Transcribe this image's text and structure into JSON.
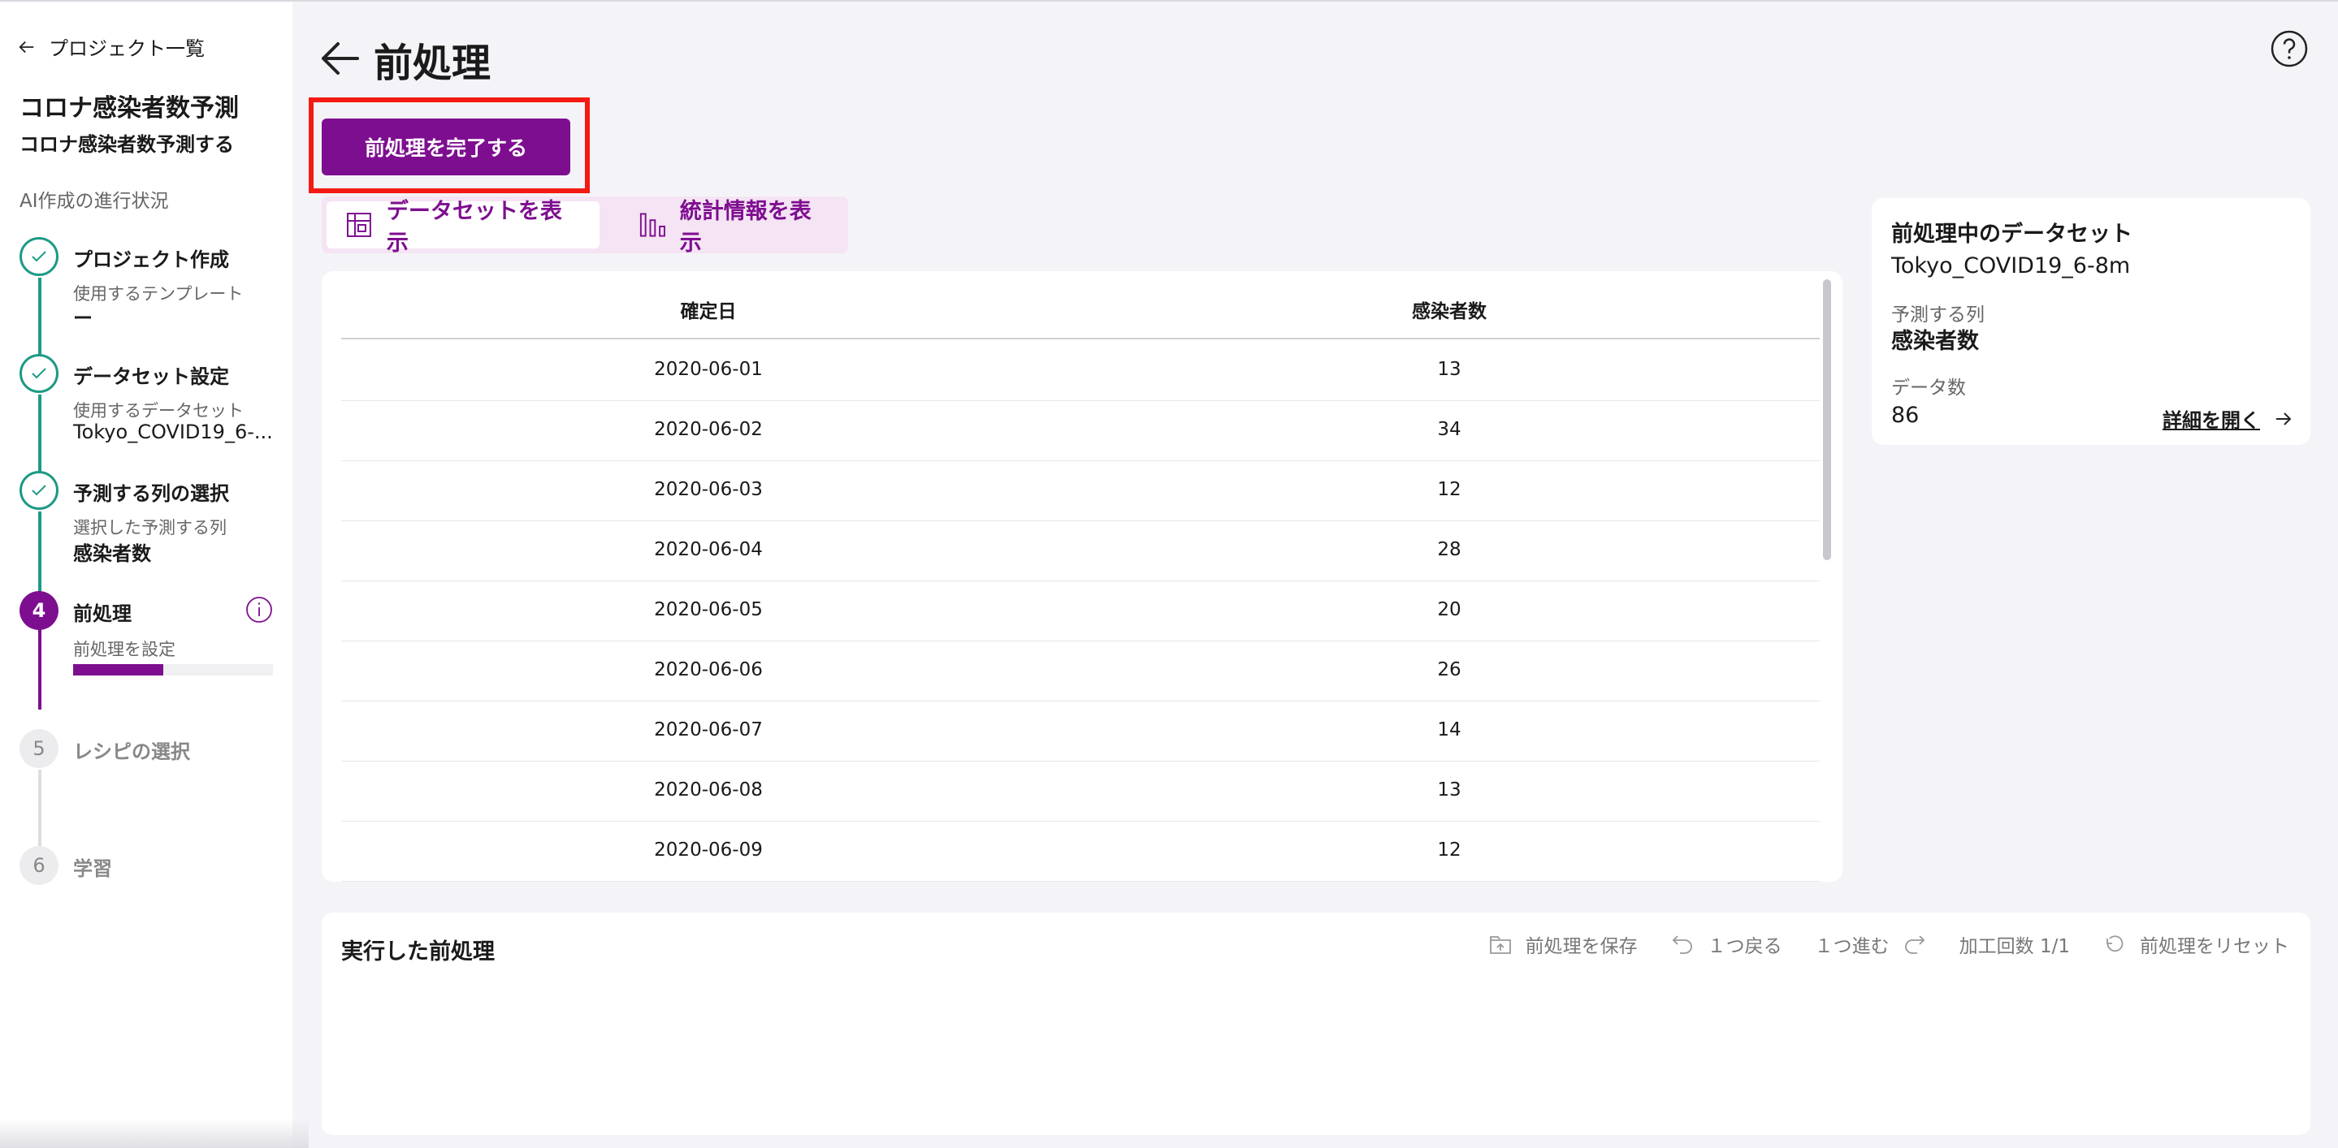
{
  "sidebar": {
    "back_label": "プロジェクト一覧",
    "project_title": "コロナ感染者数予測",
    "project_subtitle": "コロナ感染者数予測する",
    "progress_label": "AI作成の進行状況",
    "steps": [
      {
        "number": "1",
        "title": "プロジェクト作成",
        "sub": "使用するテンプレート",
        "value": "ー",
        "status": "done"
      },
      {
        "number": "2",
        "title": "データセット設定",
        "sub": "使用するデータセット",
        "value": "Tokyo_COVID19_6-...",
        "status": "done"
      },
      {
        "number": "3",
        "title": "予測する列の選択",
        "sub": "選択した予測する列",
        "value": "感染者数",
        "status": "done"
      },
      {
        "number": "4",
        "title": "前処理",
        "sub": "前処理を設定",
        "value": "",
        "status": "active",
        "progress": 0.45
      },
      {
        "number": "5",
        "title": "レシピの選択",
        "sub": "",
        "value": "",
        "status": "pending"
      },
      {
        "number": "6",
        "title": "学習",
        "sub": "",
        "value": "",
        "status": "pending"
      }
    ]
  },
  "header": {
    "title": "前処理",
    "complete_button": "前処理を完了する"
  },
  "toggles": {
    "dataset": "データセットを表示",
    "stats": "統計情報を表示"
  },
  "table": {
    "columns": [
      "確定日",
      "感染者数"
    ],
    "rows": [
      [
        "2020-06-01",
        "13"
      ],
      [
        "2020-06-02",
        "34"
      ],
      [
        "2020-06-03",
        "12"
      ],
      [
        "2020-06-04",
        "28"
      ],
      [
        "2020-06-05",
        "20"
      ],
      [
        "2020-06-06",
        "26"
      ],
      [
        "2020-06-07",
        "14"
      ],
      [
        "2020-06-08",
        "13"
      ],
      [
        "2020-06-09",
        "12"
      ]
    ]
  },
  "dataset_card": {
    "heading": "前処理中のデータセット",
    "name": "Tokyo_COVID19_6-8m",
    "target_label": "予測する列",
    "target_value": "感染者数",
    "count_label": "データ数",
    "count_value": "86",
    "detail_link": "詳細を開く"
  },
  "history": {
    "heading": "実行した前処理",
    "save": "前処理を保存",
    "undo": "１つ戻る",
    "redo": "１つ進む",
    "counter_label": "加工回数",
    "counter_value": "1/1",
    "reset": "前処理をリセット"
  },
  "colors": {
    "accent": "#7e0e90",
    "done": "#1e9a86",
    "highlight": "#f41a14"
  }
}
